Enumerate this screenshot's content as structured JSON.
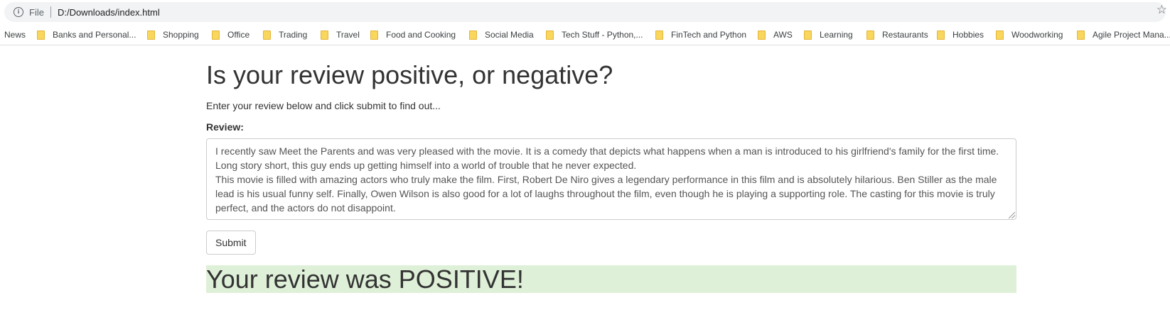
{
  "browser": {
    "scheme_label": "File",
    "url": "D:/Downloads/index.html",
    "info_icon": "info-icon",
    "star_icon": "star-icon"
  },
  "bookmarks": [
    {
      "label": "News",
      "folder": false
    },
    {
      "label": "Banks and Personal...",
      "folder": true
    },
    {
      "label": "Shopping",
      "folder": true
    },
    {
      "label": "Office",
      "folder": true
    },
    {
      "label": "Trading",
      "folder": true
    },
    {
      "label": "Travel",
      "folder": true
    },
    {
      "label": "Food and Cooking",
      "folder": true
    },
    {
      "label": "Social Media",
      "folder": true
    },
    {
      "label": "Tech Stuff - Python,...",
      "folder": true
    },
    {
      "label": "FinTech and Python",
      "folder": true
    },
    {
      "label": "AWS",
      "folder": true
    },
    {
      "label": "Learning",
      "folder": true
    },
    {
      "label": "Restaurants",
      "folder": true
    },
    {
      "label": "Hobbies",
      "folder": true
    },
    {
      "label": "Woodworking",
      "folder": true
    },
    {
      "label": "Agile Project Mana...",
      "folder": true
    }
  ],
  "page": {
    "heading": "Is your review positive, or negative?",
    "lead": "Enter your review below and click submit to find out...",
    "review_label": "Review:",
    "review_line1": "I recently saw Meet the Parents and was very pleased with the movie. It is a comedy that depicts what happens when a man is introduced to his girlfriend's family for the first time. Long story short, this guy ends up getting himself into a world of trouble that he never expected.",
    "review_line2": "This movie is filled with amazing actors who truly make the film. First, Robert De Niro gives a legendary performance in this film and is absolutely hilarious. Ben Stiller as the male lead is his usual funny self. Finally, Owen Wilson is also good for a lot of laughs throughout the film, even though he is playing a supporting role. The casting for this movie is truly perfect, and the actors do not disappoint.",
    "submit_label": "Submit",
    "result_text": "Your review was POSITIVE!"
  },
  "colors": {
    "result_background": "#dff0d8",
    "omnibox_background": "#f1f3f4",
    "folder": "#f9d65c"
  }
}
